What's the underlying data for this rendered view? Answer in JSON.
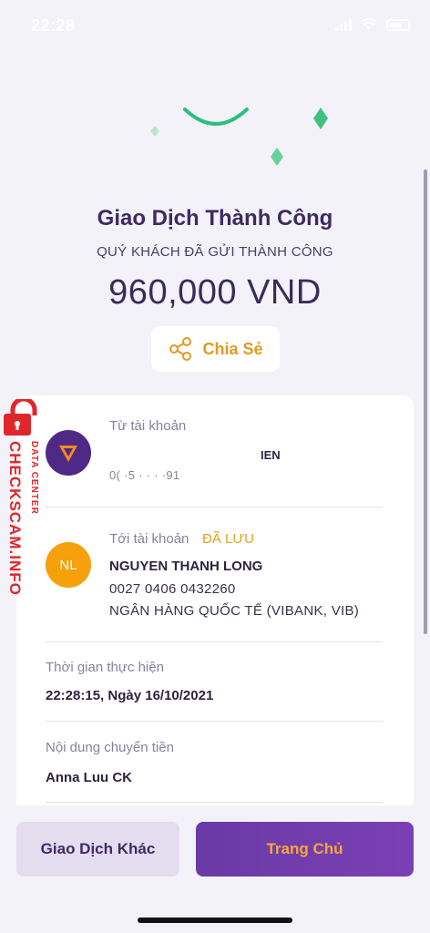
{
  "status_bar": {
    "time": "22:28"
  },
  "result": {
    "title": "Giao Dịch Thành Công",
    "subtitle": "QUÝ KHÁCH ĐÃ GỬI THÀNH CÔNG",
    "amount": "960,000 VND",
    "share_label": "Chia Sẻ"
  },
  "from_account": {
    "label": "Từ tài khoản",
    "name_partial": "IEN",
    "number_partial": "0( ·5 ·  · · ·91"
  },
  "to_account": {
    "label": "Tới tài khoản",
    "saved_badge": "ĐÃ LƯU",
    "avatar_initials": "NL",
    "name": "NGUYEN THANH LONG",
    "number": "0027 0406 0432260",
    "bank": "NGÂN HÀNG QUỐC TẾ (VIBANK, VIB)"
  },
  "time_section": {
    "label": "Thời gian thực hiện",
    "value": "22:28:15, Ngày 16/10/2021"
  },
  "content_section": {
    "label": "Nội dung chuyển tiền",
    "value": "Anna Luu CK"
  },
  "watermark": {
    "main": "CHECKSCAM.INFO",
    "sub": "DATA CENTER"
  },
  "actions": {
    "other_label": "Giao Dịch Khác",
    "home_label": "Trang Chủ"
  },
  "colors": {
    "accent": "#e39a1f",
    "brand": "#4e2a86",
    "success": "#2bbf7f"
  }
}
